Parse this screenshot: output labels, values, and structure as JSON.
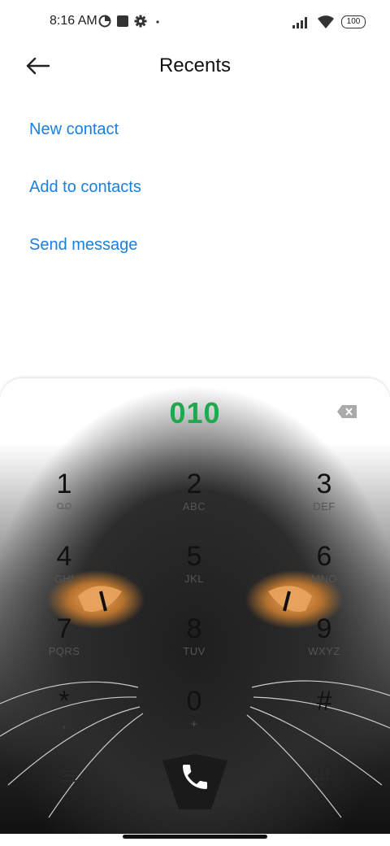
{
  "status_bar": {
    "time": "8:16 AM",
    "battery": "100",
    "icons": [
      "data-saver-icon",
      "square-notification-icon",
      "settings-gear-icon",
      "dot-icon",
      "signal-icon",
      "wifi-icon",
      "battery-icon"
    ]
  },
  "header": {
    "title": "Recents",
    "back_icon": "back-arrow-icon"
  },
  "actions": [
    {
      "label": "New contact"
    },
    {
      "label": "Add to contacts"
    },
    {
      "label": "Send message"
    }
  ],
  "dialer": {
    "number": "010",
    "backspace_icon": "backspace-icon",
    "keys": [
      {
        "digit": "1",
        "letters": ""
      },
      {
        "digit": "2",
        "letters": "ABC"
      },
      {
        "digit": "3",
        "letters": "DEF"
      },
      {
        "digit": "4",
        "letters": "GHI"
      },
      {
        "digit": "5",
        "letters": "JKL"
      },
      {
        "digit": "6",
        "letters": "MNO"
      },
      {
        "digit": "7",
        "letters": "PQRS"
      },
      {
        "digit": "8",
        "letters": "TUV"
      },
      {
        "digit": "9",
        "letters": "WXYZ"
      },
      {
        "digit": "*",
        "letters": ","
      },
      {
        "digit": "0",
        "letters": "+"
      },
      {
        "digit": "#",
        "letters": ""
      }
    ],
    "bottom_icons": [
      "menu-icon",
      "call-icon",
      "keypad-icon"
    ],
    "colors": {
      "number": "#1fa84f",
      "links": "#1a7fe0"
    }
  }
}
